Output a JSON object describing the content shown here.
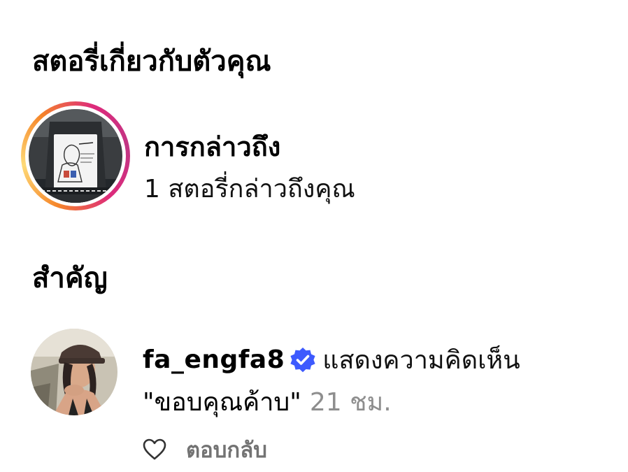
{
  "sections": {
    "stories_about_you": "สตอรี่เกี่ยวกับตัวคุณ",
    "important": "สำคัญ"
  },
  "mentions": {
    "title": "การกล่าวถึง",
    "subtitle": "1 สตอรี่กล่าวถึงคุณ",
    "ring_colors": [
      "#f58529",
      "#feda77",
      "#dd2a7b",
      "#c13584"
    ]
  },
  "activity": {
    "username": "fa_engfa8",
    "verified_icon": "verified-badge-icon",
    "action_text": "แสดงความคิดเห็น",
    "comment": "\"ขอบคุณค้าบ\"",
    "time": "21 ชม.",
    "like_icon": "heart-outline-icon",
    "reply_label": "ตอบกลับ",
    "verified_color": "#3d5afe",
    "time_color": "#8e8e8e"
  }
}
